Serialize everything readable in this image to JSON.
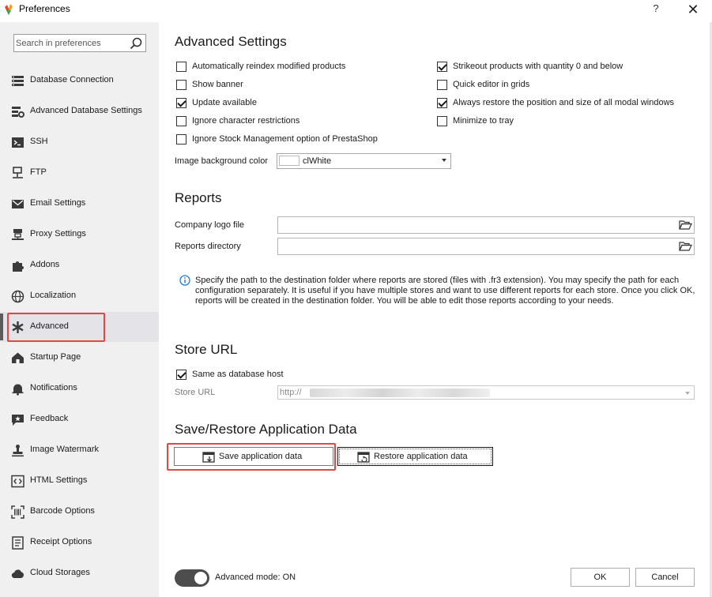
{
  "window": {
    "title": "Preferences",
    "help_label": "?",
    "close_label": "✕"
  },
  "sidebar": {
    "search_placeholder": "Search in preferences",
    "items": [
      {
        "label": "Database Connection",
        "icon": "database-icon"
      },
      {
        "label": "Advanced Database Settings",
        "icon": "database-settings-icon"
      },
      {
        "label": "SSH",
        "icon": "terminal-icon"
      },
      {
        "label": "FTP",
        "icon": "network-icon"
      },
      {
        "label": "Email Settings",
        "icon": "envelope-icon"
      },
      {
        "label": "Proxy Settings",
        "icon": "proxy-icon"
      },
      {
        "label": "Addons",
        "icon": "puzzle-icon"
      },
      {
        "label": "Localization",
        "icon": "globe-icon"
      },
      {
        "label": "Advanced",
        "icon": "asterisk-icon",
        "active": true
      },
      {
        "label": "Startup Page",
        "icon": "home-icon"
      },
      {
        "label": "Notifications",
        "icon": "bell-icon"
      },
      {
        "label": "Feedback",
        "icon": "feedback-icon"
      },
      {
        "label": "Image Watermark",
        "icon": "stamp-icon"
      },
      {
        "label": "HTML Settings",
        "icon": "code-icon"
      },
      {
        "label": "Barcode Options",
        "icon": "barcode-icon"
      },
      {
        "label": "Receipt Options",
        "icon": "receipt-icon"
      },
      {
        "label": "Cloud Storages",
        "icon": "cloud-icon"
      }
    ]
  },
  "advanced": {
    "title": "Advanced Settings",
    "left_options": [
      {
        "label": "Automatically reindex modified products",
        "checked": false
      },
      {
        "label": "Show banner",
        "checked": false
      },
      {
        "label": "Update available",
        "checked": true
      },
      {
        "label": "Ignore character restrictions",
        "checked": false
      },
      {
        "label": "Ignore Stock Management option of PrestaShop",
        "checked": false
      }
    ],
    "right_options": [
      {
        "label": "Strikeout products with quantity 0 and below",
        "checked": true
      },
      {
        "label": "Quick editor in grids",
        "checked": false
      },
      {
        "label": "Always restore the position and size of all modal windows",
        "checked": true
      },
      {
        "label": "Minimize to tray",
        "checked": false
      }
    ],
    "bg_color_label": "Image background color",
    "bg_color_value": "clWhite",
    "bg_color_hex": "#ffffff"
  },
  "reports": {
    "title": "Reports",
    "logo_label": "Company logo file",
    "logo_value": "",
    "dir_label": "Reports directory",
    "dir_value": "",
    "info": "Specify the path to the destination folder where reports are stored (files with .fr3 extension). You may specify the path for each configuration separately. It is useful if you have multiple stores and want to use different reports for each store. Once you click OK, reports will be created in the destination folder. You will be able to edit those reports according to your needs."
  },
  "store_url": {
    "title": "Store URL",
    "same_as_host_label": "Same as database host",
    "same_as_host_checked": true,
    "url_label": "Store URL",
    "url_value": "http://"
  },
  "save_restore": {
    "title": "Save/Restore Application Data",
    "save_label": "Save application data",
    "restore_label": "Restore application data"
  },
  "footer": {
    "advanced_mode_label": "Advanced mode: ON",
    "advanced_mode_on": true,
    "ok_label": "OK",
    "cancel_label": "Cancel"
  },
  "colors": {
    "highlight": "#e04848",
    "sidebar_bg": "#f0f0f0",
    "info_blue": "#1f7bd1",
    "toggle_bg": "#4d4d4d"
  }
}
